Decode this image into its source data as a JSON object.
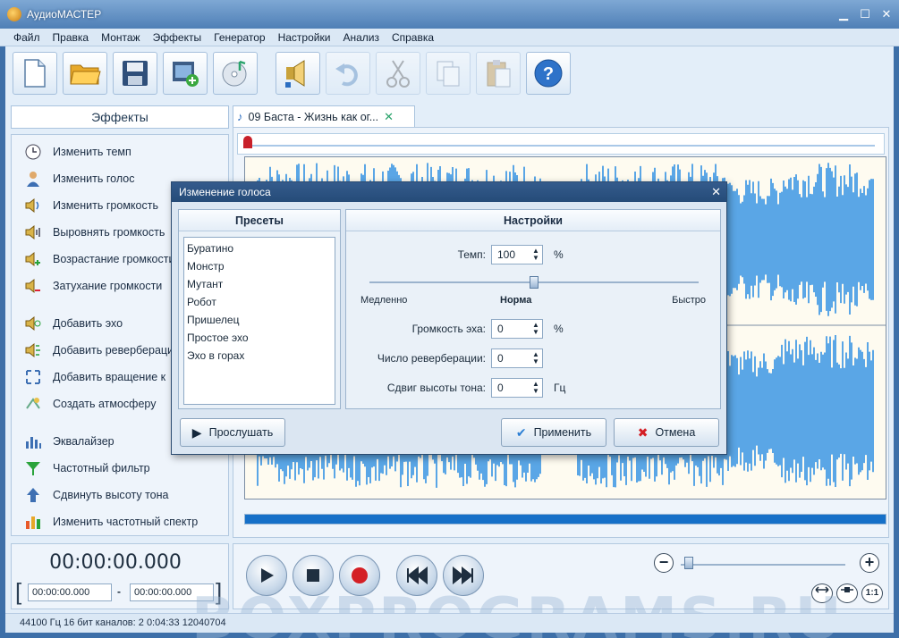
{
  "window": {
    "title": "АудиоМАСТЕР"
  },
  "menu": [
    "Файл",
    "Правка",
    "Монтаж",
    "Эффекты",
    "Генератор",
    "Настройки",
    "Анализ",
    "Справка"
  ],
  "toolbar": {
    "buttons": [
      {
        "icon": "new-file-icon"
      },
      {
        "icon": "open-folder-icon"
      },
      {
        "icon": "save-icon"
      },
      {
        "icon": "open-video-icon"
      },
      {
        "icon": "open-cd-icon"
      },
      {
        "icon": "record-icon"
      },
      {
        "icon": "undo-icon"
      },
      {
        "icon": "cut-icon"
      },
      {
        "icon": "copy-icon"
      },
      {
        "icon": "paste-icon"
      },
      {
        "icon": "help-icon"
      }
    ],
    "help_label": "?"
  },
  "effects": {
    "header": "Эффекты",
    "items": [
      {
        "label": "Изменить темп",
        "icon": "clock-icon"
      },
      {
        "label": "Изменить голос",
        "icon": "person-icon"
      },
      {
        "label": "Изменить громкость",
        "icon": "speaker-volume-icon"
      },
      {
        "label": "Выровнять громкость",
        "icon": "speaker-level-icon"
      },
      {
        "label": "Возрастание громкости",
        "icon": "volume-up-icon"
      },
      {
        "label": "Затухание громкости",
        "icon": "volume-down-icon"
      },
      {
        "label": "Добавить эхо",
        "icon": "echo-icon"
      },
      {
        "label": "Добавить реверберацию",
        "icon": "reverb-icon"
      },
      {
        "label": "Добавить вращение к",
        "icon": "rotation-icon"
      },
      {
        "label": "Создать атмосферу",
        "icon": "atmosphere-icon"
      },
      {
        "label": "Эквалайзер",
        "icon": "equalizer-icon"
      },
      {
        "label": "Частотный фильтр",
        "icon": "filter-icon"
      },
      {
        "label": "Сдвинуть высоту тона",
        "icon": "pitch-shift-icon"
      },
      {
        "label": "Изменить частотный спектр",
        "icon": "spectrum-icon"
      }
    ]
  },
  "time": {
    "current": "00:00:00.000",
    "start": "00:00:00.000",
    "end": "00:00:00.000",
    "separator": "-"
  },
  "document": {
    "tab_title": "09 Баста - Жизнь как ог..."
  },
  "status": "44100 Гц  16 бит  каналов: 2  0:04:33 12040704",
  "watermark": "BOXPROGRAMS.RU",
  "dialog": {
    "title": "Изменение голоса",
    "presets_header": "Пресеты",
    "presets": [
      "Буратино",
      "Монстр",
      "Мутант",
      "Робот",
      "Пришелец",
      "Простое эхо",
      "Эхо в горах"
    ],
    "settings_header": "Настройки",
    "tempo_label": "Темп:",
    "tempo_value": "100",
    "tempo_unit": "%",
    "tempo_level": 0.5,
    "slow_label": "Медленно",
    "normal_label": "Норма",
    "fast_label": "Быстро",
    "echo_label": "Громкость эха:",
    "echo_value": "0",
    "echo_unit": "%",
    "reverb_label": "Число реверберации:",
    "reverb_value": "0",
    "pitch_label": "Сдвиг высоты тона:",
    "pitch_value": "0",
    "pitch_unit": "Гц",
    "listen_label": "Прослушать",
    "apply_label": "Применить",
    "cancel_label": "Отмена"
  },
  "zoom": {
    "minus": "−",
    "plus": "+",
    "fit": "1:1",
    "level": 0.05
  },
  "colors": {
    "waveform": "#5aa6e6",
    "accent": "#1670c8",
    "titlebar": "#4f7fb6"
  }
}
